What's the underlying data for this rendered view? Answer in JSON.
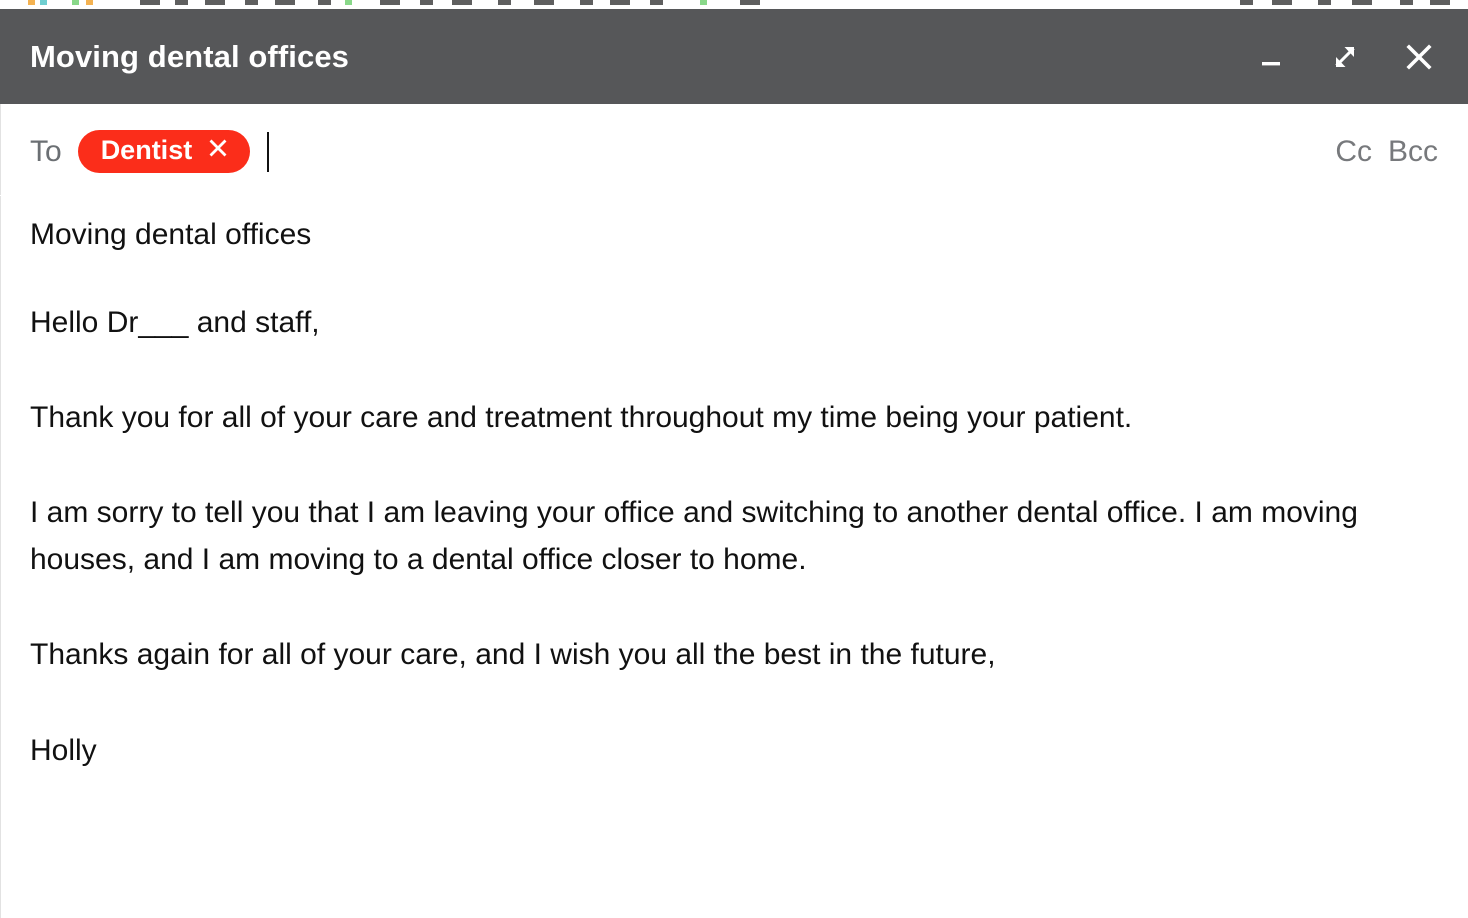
{
  "app_chrome": {
    "description": "partially-visible toolbar strip above the compose window"
  },
  "window": {
    "title": "Moving dental offices",
    "controls": [
      {
        "name": "minimize",
        "icon": "minimize-icon",
        "label": "Minimize"
      },
      {
        "name": "expand",
        "icon": "expand-icon",
        "label": "Full screen"
      },
      {
        "name": "close",
        "icon": "close-icon",
        "label": "Close"
      }
    ]
  },
  "recipients": {
    "to_label": "To",
    "chips": [
      {
        "label": "Dentist",
        "remove_icon": "close-icon",
        "color": "#FB2D1A"
      }
    ],
    "input_value": "",
    "input_placeholder": "",
    "cc_label": "Cc",
    "bcc_label": "Bcc"
  },
  "compose": {
    "subject": "Moving dental offices",
    "body": {
      "greeting": "Hello Dr___ and staff,",
      "paragraph_1": "Thank you for all of your care and treatment throughout my time being your patient.",
      "paragraph_2": "I am sorry to tell you that I am leaving your office and switching to another dental office. I am moving houses, and I am moving to a dental office closer to home.",
      "paragraph_3": "Thanks again for all of your care, and I wish you all the best in the future,",
      "signature": "Holly"
    }
  },
  "colors": {
    "titlebar_bg": "#565759",
    "titlebar_text": "#FFFFFF",
    "chip_bg": "#FB2D1A",
    "body_text": "#111111",
    "muted_text": "#6B6F73",
    "page_bg": "#FFFFFF"
  }
}
